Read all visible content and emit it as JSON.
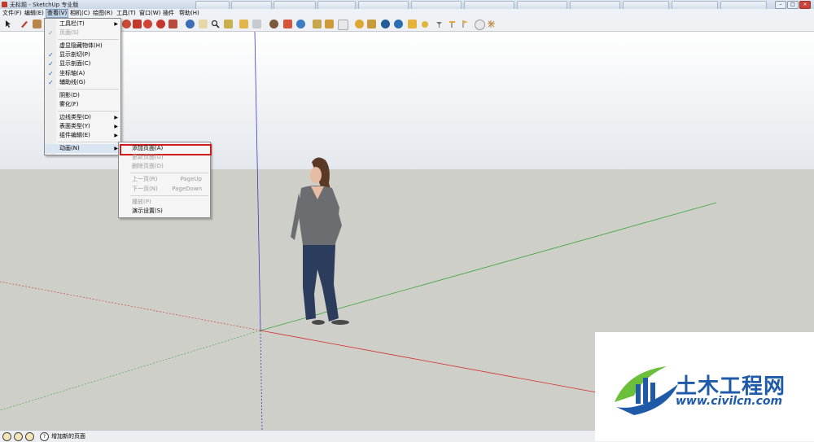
{
  "window": {
    "title": "无标题 - SketchUp 专业版",
    "controls": [
      "–",
      "□",
      "×"
    ]
  },
  "menubar": {
    "items": [
      "文件(F)",
      "编辑(E)",
      "查看(V)",
      "相机(C)",
      "绘图(R)",
      "工具(T)",
      "窗口(W)",
      "插件",
      "帮助(H)"
    ],
    "active_index": 2
  },
  "view_menu": {
    "items": [
      {
        "label": "工具栏(T)",
        "submenu": true
      },
      {
        "label": "页面(S)",
        "checked": true,
        "disabled": true
      },
      {
        "label": "虚显隐藏物体(H)"
      },
      {
        "label": "显示剖切(P)",
        "checked": true
      },
      {
        "label": "显示剖面(C)",
        "checked": true
      },
      {
        "label": "坐标轴(A)",
        "checked": true
      },
      {
        "label": "辅助线(G)",
        "checked": true
      },
      {
        "label": "阴影(D)"
      },
      {
        "label": "雾化(F)"
      },
      {
        "label": "边线类型(D)",
        "submenu": true
      },
      {
        "label": "表面类型(Y)",
        "submenu": true
      },
      {
        "label": "组件编辑(E)",
        "submenu": true
      },
      {
        "label": "动画(N)",
        "submenu": true,
        "hover": true
      }
    ]
  },
  "animation_submenu": {
    "items": [
      {
        "label": "添加页面(A)",
        "highlighted": true
      },
      {
        "label": "更新页面(U)",
        "disabled": true
      },
      {
        "label": "删除页面(D)",
        "disabled": true
      },
      {
        "label": "上一页(R)",
        "shortcut": "PageUp",
        "disabled": true
      },
      {
        "label": "下一页(N)",
        "shortcut": "PageDown",
        "disabled": true
      },
      {
        "label": "播放(P)",
        "disabled": true
      },
      {
        "label": "演示设置(S)"
      }
    ]
  },
  "statusbar": {
    "text": "增加新的页面",
    "help_icon": "?"
  },
  "watermark": {
    "name": "土木工程网",
    "url": "www.civilcn.com"
  },
  "colors": {
    "axis_red": "#d22b2b",
    "axis_green": "#3aa63a",
    "axis_blue": "#3b3bc8",
    "highlight_border": "#d11a1a",
    "brand_blue": "#1e5aa8",
    "brand_green": "#6bbf3a"
  },
  "icons": {
    "toolbar": [
      "select-arrow-icon",
      "pencil-icon",
      "rectangle-icon",
      "push-pull-icon",
      "move-icon",
      "rotate-icon",
      "offset-icon",
      "orbit-icon",
      "pan-icon",
      "zoom-icon",
      "zoom-extents-icon",
      "sections-icon",
      "fog-icon",
      "geo-location-icon",
      "photo-textures-icon",
      "shadows-icon",
      "sandbox-icon",
      "warehouse-icon",
      "sun-icon",
      "share-icon"
    ]
  }
}
